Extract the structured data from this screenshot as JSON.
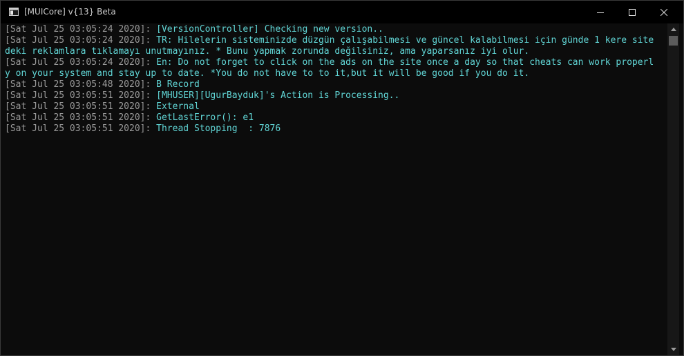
{
  "window": {
    "title": "[MUICore] v{13} Beta",
    "icon": "console-app-icon",
    "controls": {
      "minimize_icon": "minimize-icon",
      "maximize_icon": "maximize-icon",
      "close_icon": "close-icon"
    }
  },
  "colors": {
    "background": "#0c0c0c",
    "timestamp": "#9a9a9a",
    "message": "#61d6d6",
    "titlebar": "#000000"
  },
  "console": {
    "lines": [
      {
        "ts": "[Sat Jul 25 03:05:24 2020]:",
        "msg": " [VersionController] Checking new version.."
      },
      {
        "ts": "[Sat Jul 25 03:05:24 2020]:",
        "msg": " TR: Hilelerin sisteminizde düzgün çalışabilmesi ve güncel kalabilmesi için günde 1 kere site"
      },
      {
        "ts": "",
        "msg": "deki reklamlara tıklamayı unutmayınız. * Bunu yapmak zorunda değilsiniz, ama yaparsanız iyi olur."
      },
      {
        "ts": "[Sat Jul 25 03:05:24 2020]:",
        "msg": " En: Do not forget to click on the ads on the site once a day so that cheats can work properl"
      },
      {
        "ts": "",
        "msg": "y on your system and stay up to date. *You do not have to to it,but it will be good if you do it."
      },
      {
        "ts": "[Sat Jul 25 03:05:48 2020]:",
        "msg": " B Record"
      },
      {
        "ts": "[Sat Jul 25 03:05:51 2020]:",
        "msg": " [MHUSER][UgurBayduk]'s Action is Processing.."
      },
      {
        "ts": "[Sat Jul 25 03:05:51 2020]:",
        "msg": " External"
      },
      {
        "ts": "[Sat Jul 25 03:05:51 2020]:",
        "msg": " GetLastError(): e1"
      },
      {
        "ts": "[Sat Jul 25 03:05:51 2020]:",
        "msg": " Thread Stopping  : 7876"
      }
    ]
  },
  "scrollbar": {
    "up_icon": "scroll-up-arrow-icon",
    "down_icon": "scroll-down-arrow-icon"
  }
}
